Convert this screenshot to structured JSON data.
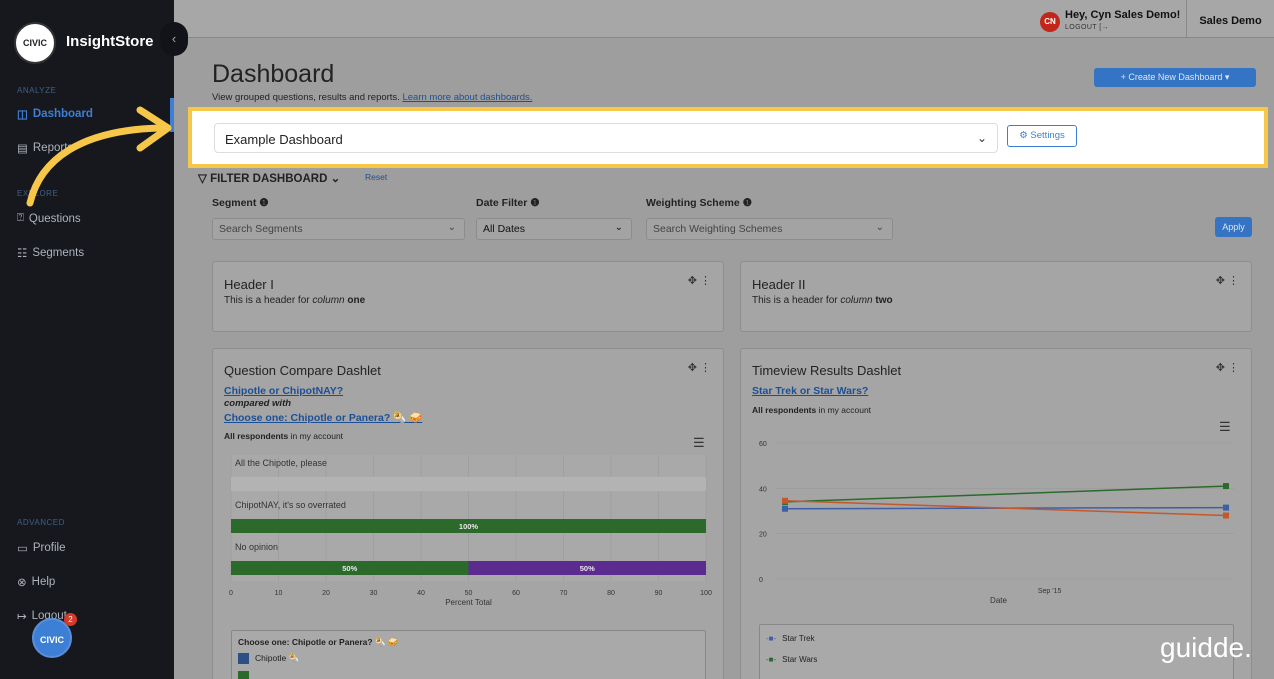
{
  "sidebar": {
    "logo_mark": "CIVIC",
    "app_name": "InsightStore",
    "sections": [
      "ANALYZE",
      "EXPLORE",
      "ADVANCED"
    ],
    "analyze_items": [
      "Dashboard",
      "Reports"
    ],
    "explore_items": [
      "Questions",
      "Segments"
    ],
    "advanced_items": [
      "Profile",
      "Help",
      "Logout"
    ],
    "notification_count": "2",
    "avatar_text": "CIVIC"
  },
  "topbar": {
    "avatar_initials": "CN",
    "greeting": "Hey, Cyn Sales Demo!",
    "logout": "LOGOUT",
    "account": "Sales Demo"
  },
  "page": {
    "title": "Dashboard",
    "subtitle": "View grouped questions, results and reports.",
    "learn_link": "Learn more about dashboards.",
    "create_button": "+ Create New Dashboard"
  },
  "dashboard_select": {
    "value": "Example Dashboard",
    "settings": "Settings"
  },
  "filter": {
    "heading": "FILTER DASHBOARD",
    "reset": "Reset",
    "segment_label": "Segment",
    "segment_placeholder": "Search Segments",
    "date_label": "Date Filter",
    "date_value": "All Dates",
    "weighting_label": "Weighting Scheme",
    "weighting_placeholder": "Search Weighting Schemes",
    "apply": "Apply"
  },
  "header1": {
    "title": "Header I",
    "text_pre": "This is a header for ",
    "text_em": "column",
    "text_strong": "one"
  },
  "header2": {
    "title": "Header II",
    "text_pre": "This is a header for ",
    "text_em": "column",
    "text_strong": "two"
  },
  "compare": {
    "title": "Question Compare Dashlet",
    "q1": "Chipotle or ChipotNAY?",
    "compared_with": "compared with",
    "q2": "Choose one: Chipotle or Panera? 🌯 🥪",
    "respondents_bold": "All respondents",
    "respondents_rest": " in my account",
    "legend_title": "Choose one: Chipotle or Panera? 🌯 🥪",
    "legend_item": "Chipotle 🌯"
  },
  "timeview": {
    "title": "Timeview Results Dashlet",
    "q": "Star Trek or Star Wars?",
    "respondents_bold": "All respondents",
    "respondents_rest": " in my account",
    "legend": [
      "Star Trek",
      "Star Wars"
    ]
  },
  "chart_data": [
    {
      "type": "bar",
      "orientation": "horizontal",
      "categories": [
        "All the Chipotle, please",
        "ChipotNAY, it's so overrated",
        "No opinion"
      ],
      "series": [
        {
          "name": "Chipotle 🌯",
          "color": "#2b6a2b",
          "values": [
            0,
            100,
            50
          ]
        },
        {
          "color": "#5b2b8f",
          "values": [
            0,
            0,
            50
          ]
        }
      ],
      "data_labels": [
        "100%",
        "50%",
        "50%"
      ],
      "xlabel": "Percent Total",
      "xlim": [
        0,
        100
      ],
      "xticks": [
        0,
        10,
        20,
        30,
        40,
        50,
        60,
        70,
        80,
        90,
        100
      ],
      "grid": true
    },
    {
      "type": "line",
      "x": [
        "",
        "Sep '15"
      ],
      "series": [
        {
          "name": "Star Trek",
          "color": "#3d5fa8",
          "values": [
            31,
            31.5
          ]
        },
        {
          "name": "Star Wars",
          "color": "#2b6a2b",
          "values": [
            34,
            41
          ]
        },
        {
          "color": "#c4582b",
          "values": [
            34.5,
            28
          ]
        }
      ],
      "xlabel": "Date",
      "ylim": [
        0,
        60
      ],
      "yticks": [
        0,
        20,
        40,
        60
      ],
      "grid": true,
      "legend": "bottom"
    }
  ],
  "watermark": "guidde."
}
